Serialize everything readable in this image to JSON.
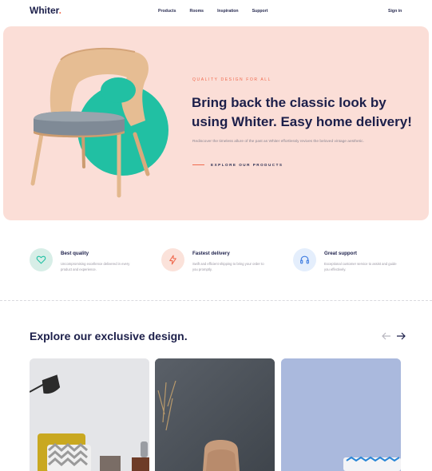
{
  "nav": {
    "logo": "Whiter",
    "logo_dot": ".",
    "links": [
      "Products",
      "Rooms",
      "Inspiration",
      "Support"
    ],
    "signin": "Sign in"
  },
  "hero": {
    "eyebrow": "QUALITY DESIGN FOR ALL",
    "headline": "Bring back the classic look by using Whiter. Easy home delivery!",
    "subtext": "Rediscover the timeless allure of the past as Whiter effortlessly revives the beloved vintage aesthetic.",
    "cta": "EXPLORE OUR PRODUCTS"
  },
  "features": [
    {
      "title": "Best quality",
      "description": "Uncompromising excellence delivered in every product and experience.",
      "icon": "heart-icon"
    },
    {
      "title": "Fastest delivery",
      "description": "Swift and efficient shipping to bring your order to you promptly.",
      "icon": "lightning-icon"
    },
    {
      "title": "Great support",
      "description": "Exceptional customer service to assist and guide you effectively.",
      "icon": "headphones-icon"
    }
  ],
  "section": {
    "title": "Explore our exclusive design."
  },
  "colors": {
    "accent": "#f06a4e",
    "hero_bg": "#fbded7",
    "teal": "#21c0a3",
    "navy": "#1c1f4a"
  }
}
